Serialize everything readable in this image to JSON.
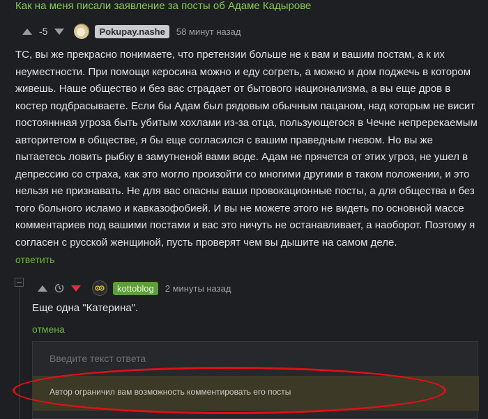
{
  "post": {
    "title": "Как на меня писали заявление за посты об Адаме Кадырове"
  },
  "comment1": {
    "score": "-5",
    "username": "Pokupay.nashe",
    "time": "58 минут назад",
    "body": "ТС, вы же прекрасно понимаете, что претензии больше не к вам и вашим постам, а к их неуместности. При помощи керосина можно и еду согреть, а можно и дом поджечь в котором живешь. Наше общество и без вас страдает от бытового национализма, а вы еще дров в костер подбрасываете. Если бы Адам был рядовым обычным пацаном, над которым не висит постояннная угроза быть убитым хохлами из-за отца, пользующегося в Чечне непререкаемым авторитетом в обществе, я бы еще согласился с вашим праведным гневом. Но вы же пытаетесь ловить рыбку в замутненой вами воде. Адам не прячется от этих угроз, не ушел в депрессию со страха, как это могло произойти со многими другими в таком положении, и это нельзя не признавать. Не для вас опасны ваши провокационные посты, а для общества и без того больного исламо и кавказофобией. И вы не можете этого не видеть по основной массе комментариев под вашими постами и вас это ничуть не останавливает, а наоборот. Поэтому я согласен с русской женщиной, пусть проверят чем вы дышите на самом деле.",
    "reply_label": "ответить"
  },
  "comment2": {
    "username": "kottoblog",
    "time": "2 минуты назад",
    "body": "Еще одна \"Катерина\".",
    "cancel_label": "отмена"
  },
  "reply_form": {
    "placeholder": "Введите текст ответа",
    "restriction": "Автор ограничил вам возможность комментировать его посты"
  },
  "colors": {
    "background": "#1d1f22",
    "link_green": "#6cb343",
    "downvote_red": "#d8333a",
    "annotation_red": "#e01018",
    "restriction_bg": "#3c3a26"
  },
  "icons": [
    "upvote-arrow-icon",
    "downvote-arrow-icon",
    "clock-icon",
    "avatar-icon"
  ]
}
